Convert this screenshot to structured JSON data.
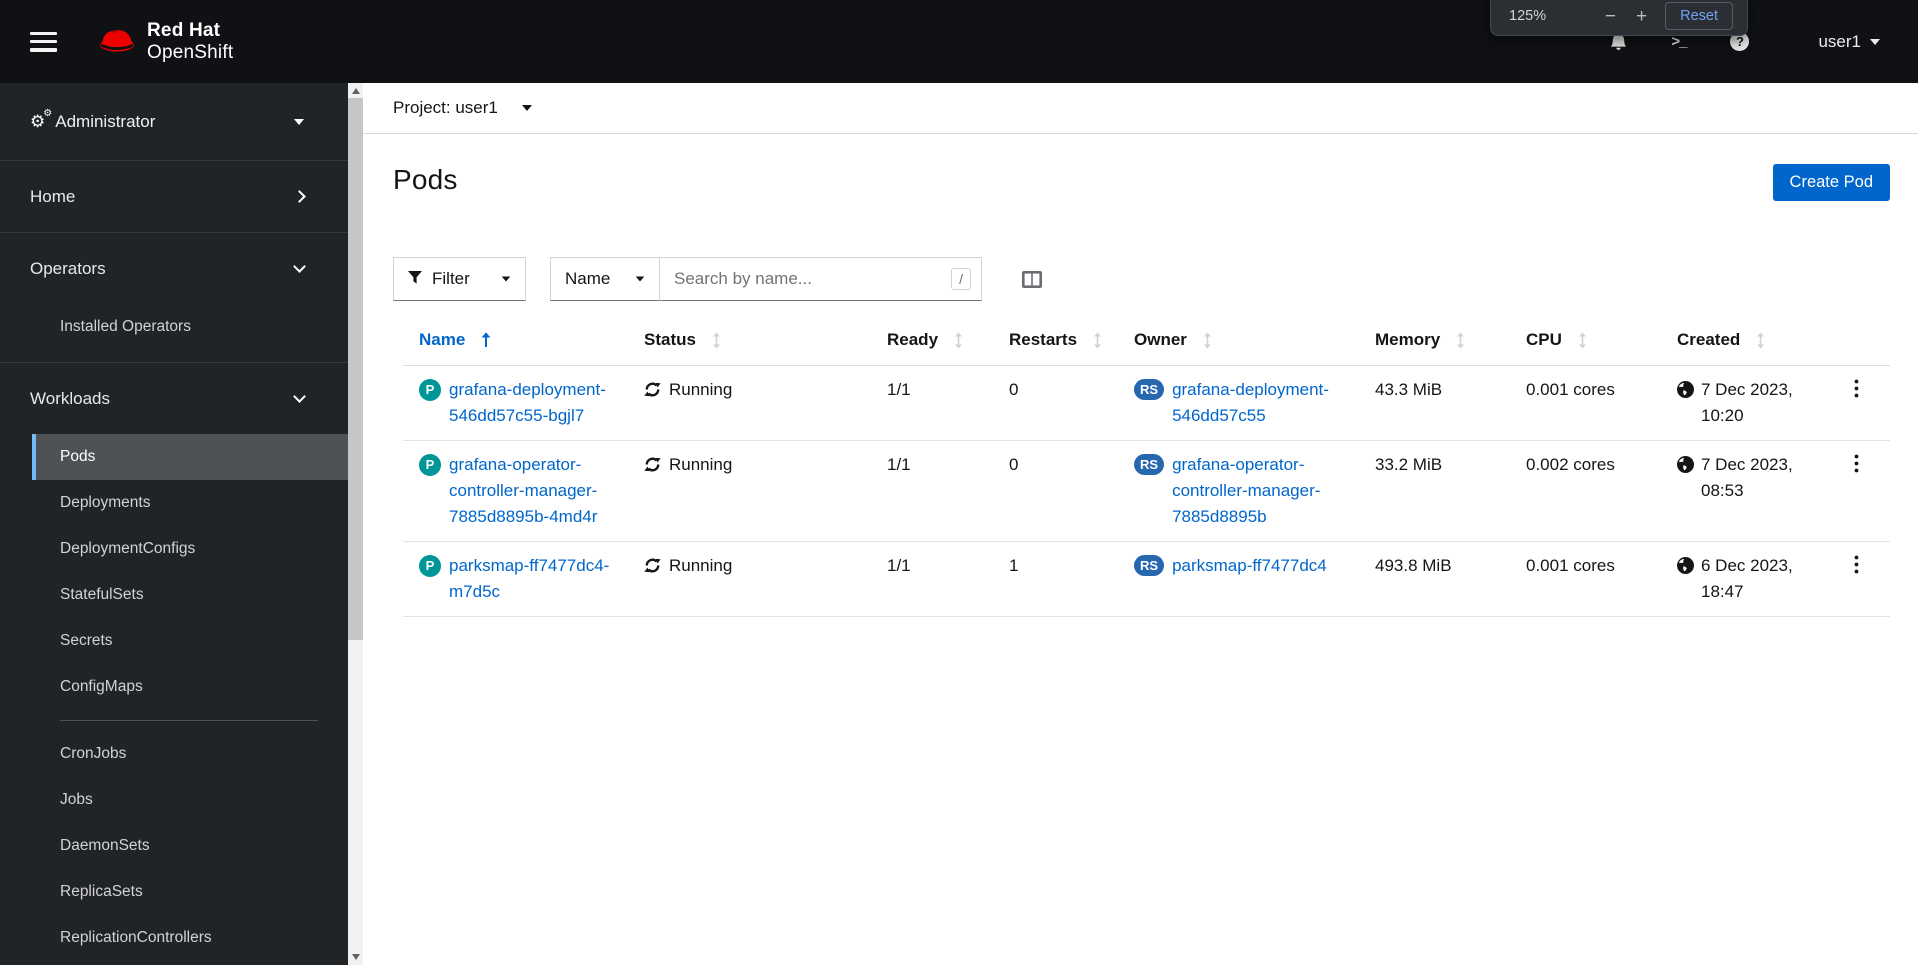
{
  "colors": {
    "primary": "#0066cc",
    "brand_red": "#ee0000",
    "link": "#0066cc",
    "pod_badge": "#009596",
    "replicaset_badge": "#2667b0",
    "nav_current_indicator": "#73bcf7",
    "masthead_bg": "#0f1114",
    "sidebar_bg": "#212427"
  },
  "masthead": {
    "brand": {
      "line1": "Red Hat",
      "line2": "OpenShift"
    },
    "user": {
      "name": "user1"
    }
  },
  "zoom_popup": {
    "level": "125%",
    "minus": "−",
    "plus": "+",
    "reset_label": "Reset"
  },
  "sidebar": {
    "perspective": {
      "label": "Administrator"
    },
    "home": {
      "label": "Home"
    },
    "operators": {
      "label": "Operators",
      "items": [
        "Installed Operators"
      ]
    },
    "workloads": {
      "label": "Workloads",
      "selected": "Pods",
      "items_group1": [
        "Pods",
        "Deployments",
        "DeploymentConfigs",
        "StatefulSets",
        "Secrets",
        "ConfigMaps"
      ],
      "items_group2": [
        "CronJobs",
        "Jobs",
        "DaemonSets",
        "ReplicaSets",
        "ReplicationControllers"
      ]
    }
  },
  "content": {
    "project_selector": {
      "label": "Project: user1"
    },
    "title": "Pods",
    "create_button": "Create Pod",
    "toolbar": {
      "filter_label": "Filter",
      "attribute_label": "Name",
      "search_placeholder": "Search by name...",
      "shortcut_hint": "/"
    },
    "table": {
      "columns": [
        "Name",
        "Status",
        "Ready",
        "Restarts",
        "Owner",
        "Memory",
        "CPU",
        "Created"
      ],
      "sorted_column": "Name",
      "sort_direction": "ascending",
      "rows": [
        {
          "badge": "P",
          "name": "grafana-deployment-546dd57c55-bgjl7",
          "status": "Running",
          "ready": "1/1",
          "restarts": "0",
          "owner_badge": "RS",
          "owner": "grafana-deployment-546dd57c55",
          "memory": "43.3 MiB",
          "cpu": "0.001 cores",
          "created": "7 Dec 2023, 10:20"
        },
        {
          "badge": "P",
          "name": "grafana-operator-controller-manager-7885d8895b-4md4r",
          "status": "Running",
          "ready": "1/1",
          "restarts": "0",
          "owner_badge": "RS",
          "owner": "grafana-operator-controller-manager-7885d8895b",
          "memory": "33.2 MiB",
          "cpu": "0.002 cores",
          "created": "7 Dec 2023, 08:53"
        },
        {
          "badge": "P",
          "name": "parksmap-ff7477dc4-m7d5c",
          "status": "Running",
          "ready": "1/1",
          "restarts": "1",
          "owner_badge": "RS",
          "owner": "parksmap-ff7477dc4",
          "memory": "493.8 MiB",
          "cpu": "0.001 cores",
          "created": "6 Dec 2023, 18:47"
        }
      ]
    }
  }
}
